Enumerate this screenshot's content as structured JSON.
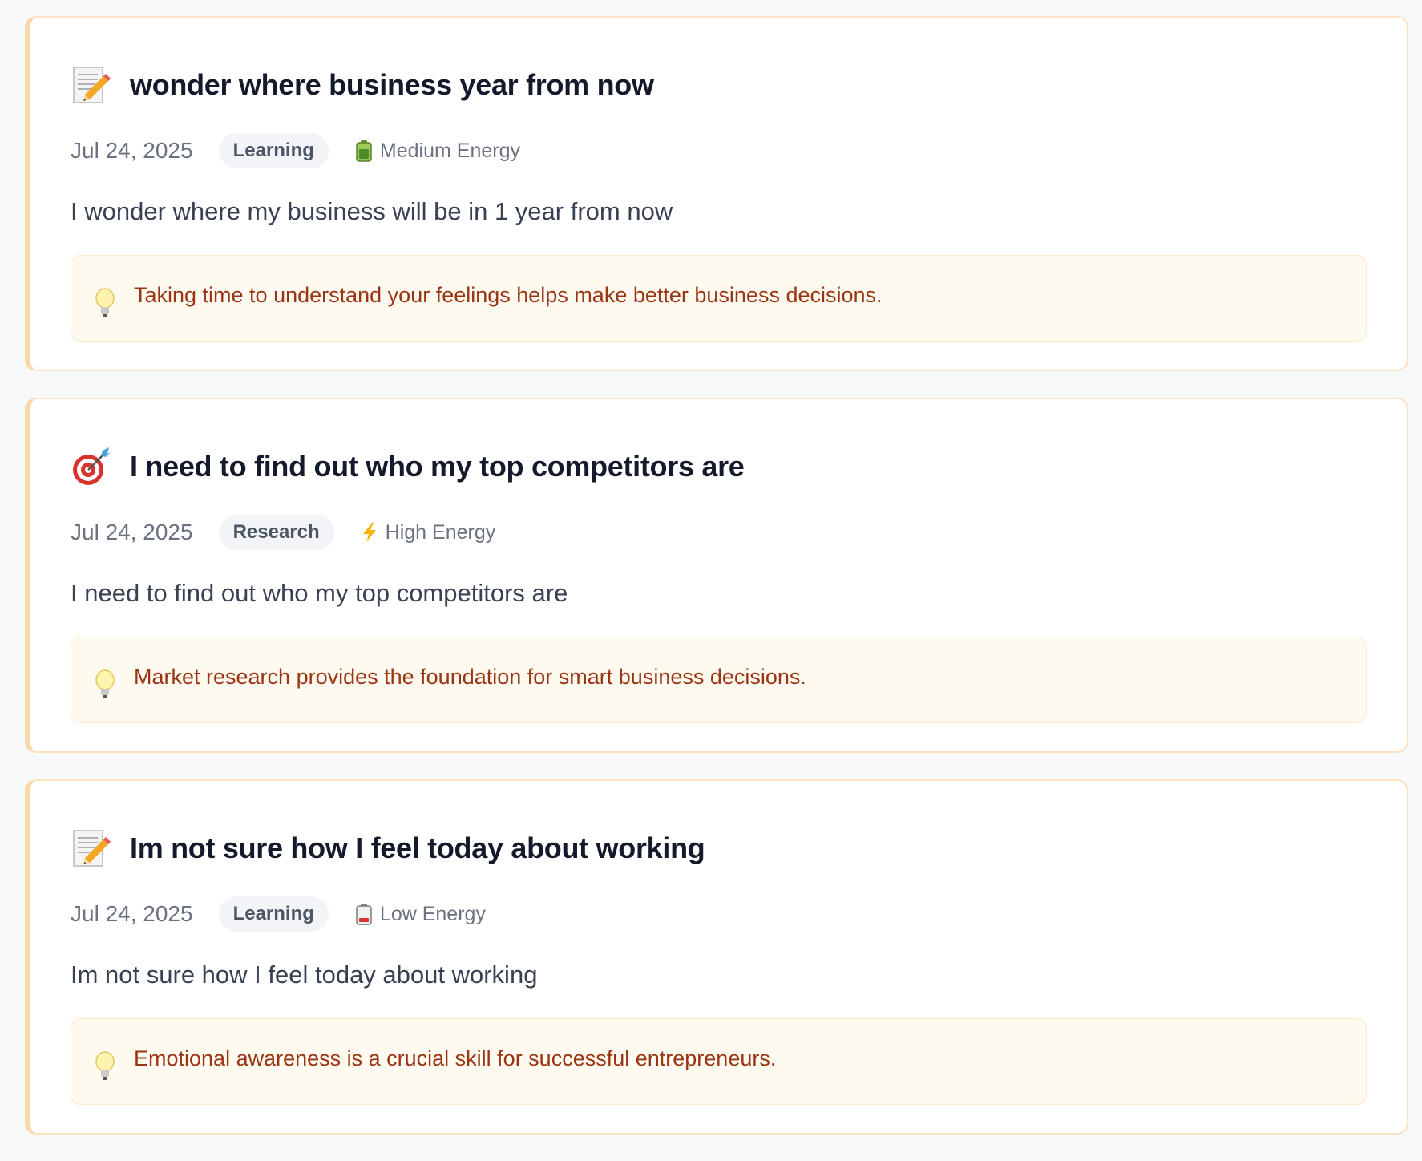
{
  "entries": [
    {
      "icon": "memo-icon",
      "title": "wonder where business year from now",
      "date": "Jul 24, 2025",
      "category": "Learning",
      "energy_icon": "battery-medium-icon",
      "energy": "Medium Energy",
      "body": "I wonder where my business will be in 1 year from now",
      "insight": "Taking time to understand your feelings helps make better business decisions."
    },
    {
      "icon": "target-icon",
      "title": "I need to find out who my top competitors are",
      "date": "Jul 24, 2025",
      "category": "Research",
      "energy_icon": "lightning-icon",
      "energy": "High Energy",
      "body": "I need to find out who my top competitors are",
      "insight": "Market research provides the foundation for smart business decisions."
    },
    {
      "icon": "memo-icon",
      "title": "Im not sure how I feel today about working",
      "date": "Jul 24, 2025",
      "category": "Learning",
      "energy_icon": "battery-low-icon",
      "energy": "Low Energy",
      "body": "Im not sure how I feel today about working",
      "insight": "Emotional awareness is a crucial skill for successful entrepreneurs."
    }
  ],
  "colors": {
    "card_border": "#fbe1bd",
    "insight_bg": "#fffaf0",
    "insight_text": "#9a3412",
    "title_text": "#141a2b"
  }
}
